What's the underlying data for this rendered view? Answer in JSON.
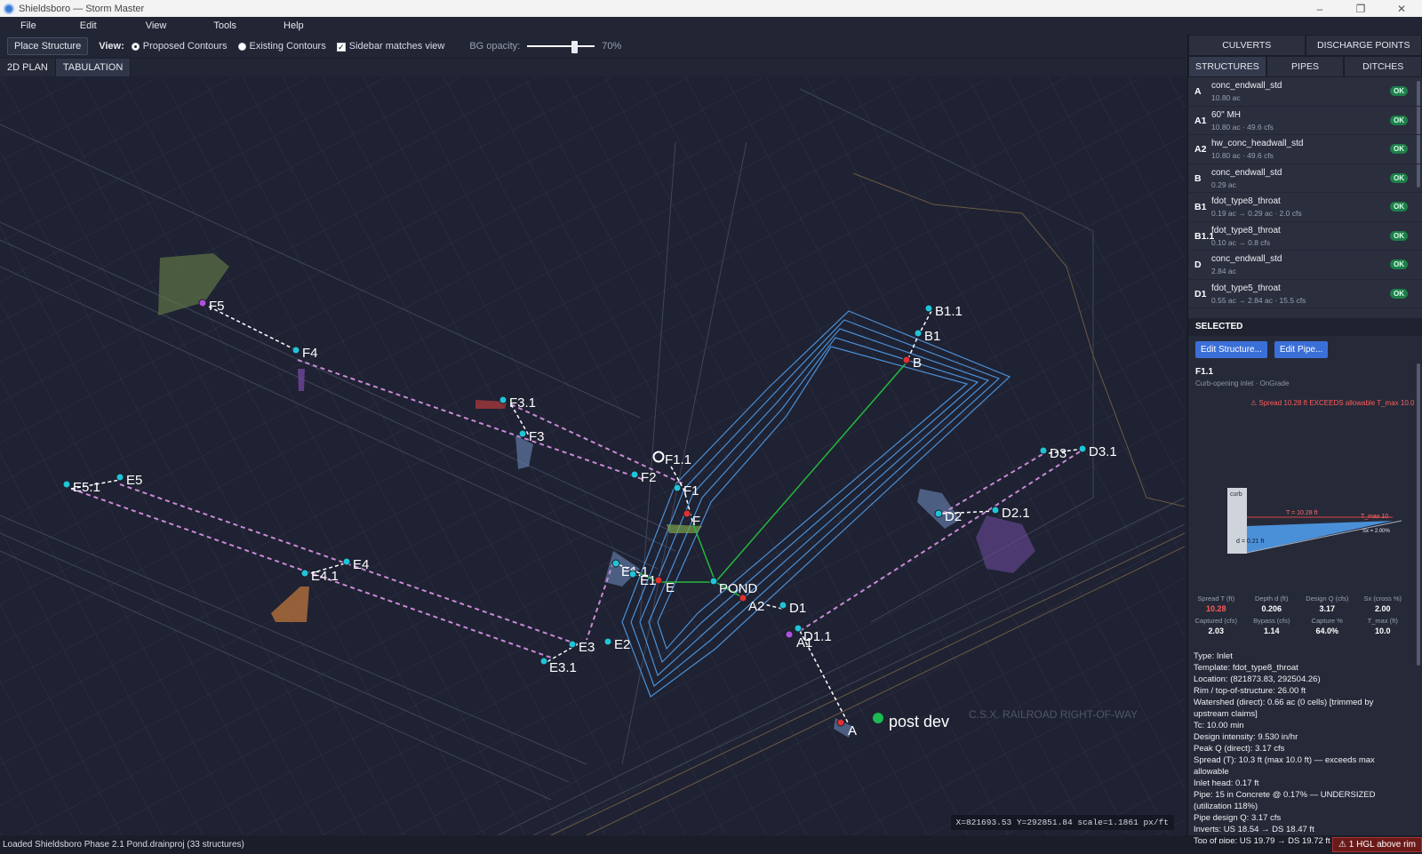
{
  "window": {
    "title": "Shieldsboro — Storm Master",
    "controls": [
      "–",
      "❐",
      "✕"
    ]
  },
  "menu": [
    "File",
    "Edit",
    "View",
    "Tools",
    "Help"
  ],
  "toolbar": {
    "place_structure": "Place Structure",
    "view_label": "View:",
    "proposed_contours": "Proposed Contours",
    "existing_contours": "Existing Contours",
    "sidebar_matches_view": "Sidebar matches view",
    "bg_opacity_label": "BG opacity:",
    "bg_opacity_value": "70%",
    "bg_opacity_fraction": 0.7
  },
  "tabs": [
    "2D PLAN",
    "TABULATION"
  ],
  "canvas": {
    "coord_readout": "X=821693.53  Y=292851.84  scale=1.1861 px/ft",
    "annotation": "post dev",
    "railroad": "C.S.X. RAILROAD RIGHT-OF-WAY",
    "nodes": [
      "B1.1",
      "B1",
      "B",
      "F5",
      "F4",
      "F3.1",
      "F3",
      "F1.1",
      "F2",
      "F1",
      "F",
      "E5.1",
      "E5",
      "E4",
      "E4.1",
      "E1.1",
      "E1",
      "E",
      "POND",
      "A2",
      "D1",
      "D1.1",
      "A1",
      "E3",
      "E2",
      "E3.1",
      "D3",
      "D3.1",
      "D2",
      "D2.1",
      "A"
    ]
  },
  "status": {
    "message": "Loaded Shieldsboro Phase 2.1 Pond.drainproj (33 structures)",
    "hgl": "⚠ 1 HGL above rim"
  },
  "sidebar": {
    "tabs_row1": [
      "CULVERTS",
      "DISCHARGE POINTS"
    ],
    "tabs_row2": [
      "STRUCTURES",
      "PIPES",
      "DITCHES"
    ],
    "structures": [
      {
        "id": "A",
        "name": "conc_endwall_std",
        "meta": "10.80 ac",
        "status": "OK"
      },
      {
        "id": "A1",
        "name": "60\" MH",
        "meta": "10.80 ac · 49.6 cfs",
        "status": "OK"
      },
      {
        "id": "A2",
        "name": "hw_conc_headwall_std",
        "meta": "10.80 ac · 49.6 cfs",
        "status": "OK"
      },
      {
        "id": "B",
        "name": "conc_endwall_std",
        "meta": "0.29 ac",
        "status": "OK"
      },
      {
        "id": "B1",
        "name": "fdot_type8_throat",
        "meta": "0.19 ac → 0.29 ac · 2.0 cfs",
        "status": "OK"
      },
      {
        "id": "B1.1",
        "name": "fdot_type8_throat",
        "meta": "0.10 ac → 0.8 cfs",
        "status": "OK"
      },
      {
        "id": "D",
        "name": "conc_endwall_std",
        "meta": "2.84 ac",
        "status": "OK"
      },
      {
        "id": "D1",
        "name": "fdot_type5_throat",
        "meta": "0.55 ac → 2.84 ac · 15.5 cfs",
        "status": "OK"
      }
    ],
    "selected": {
      "header": "SELECTED",
      "edit_structure": "Edit Structure...",
      "edit_pipe": "Edit Pipe...",
      "name": "F1.1",
      "subtitle": "Curb-opening inlet · OnGrade",
      "warning": "⚠ Spread 10.28 ft EXCEEDS allowable T_max 10.0",
      "diagram": {
        "curb": "curb",
        "t_label": "T = 10.28 ft",
        "tmax_label": "T_max 10",
        "d_label": "d = 0.21 ft",
        "sx_label": "Sx = 2.00%"
      },
      "metrics": [
        {
          "h": "Spread T (ft)",
          "v": "10.28",
          "red": true
        },
        {
          "h": "Depth d (ft)",
          "v": "0.206"
        },
        {
          "h": "Design Q (cfs)",
          "v": "3.17"
        },
        {
          "h": "Sx (cross %)",
          "v": "2.00"
        },
        {
          "h": "Captured (cfs)",
          "v": "2.03"
        },
        {
          "h": "Bypass (cfs)",
          "v": "1.14"
        },
        {
          "h": "Capture %",
          "v": "64.0%"
        },
        {
          "h": "T_max (ft)",
          "v": "10.0"
        }
      ],
      "details": [
        "Type: Inlet",
        "Template: fdot_type8_throat",
        "Location: (821873.83, 292504.26)",
        "Rim / top-of-structure: 26.00 ft",
        "Watershed (direct): 0.66 ac (0 cells) [trimmed by upstream claims]",
        "Tc: 10.00 min",
        "Design intensity: 9.530 in/hr",
        "Peak Q (direct): 3.17 cfs",
        "Spread (T): 10.3 ft (max 10.0 ft) — exceeds max allowable",
        "Inlet head: 0.17 ft",
        "Pipe: 15 in Concrete @ 0.17% — UNDERSIZED (utilization 118%)",
        "Pipe design Q: 3.17 cfs",
        "Inverts: US 18.54 → DS 18.47 ft",
        "Top of pipe: US 19.79 → DS 19.72 ft"
      ]
    }
  }
}
